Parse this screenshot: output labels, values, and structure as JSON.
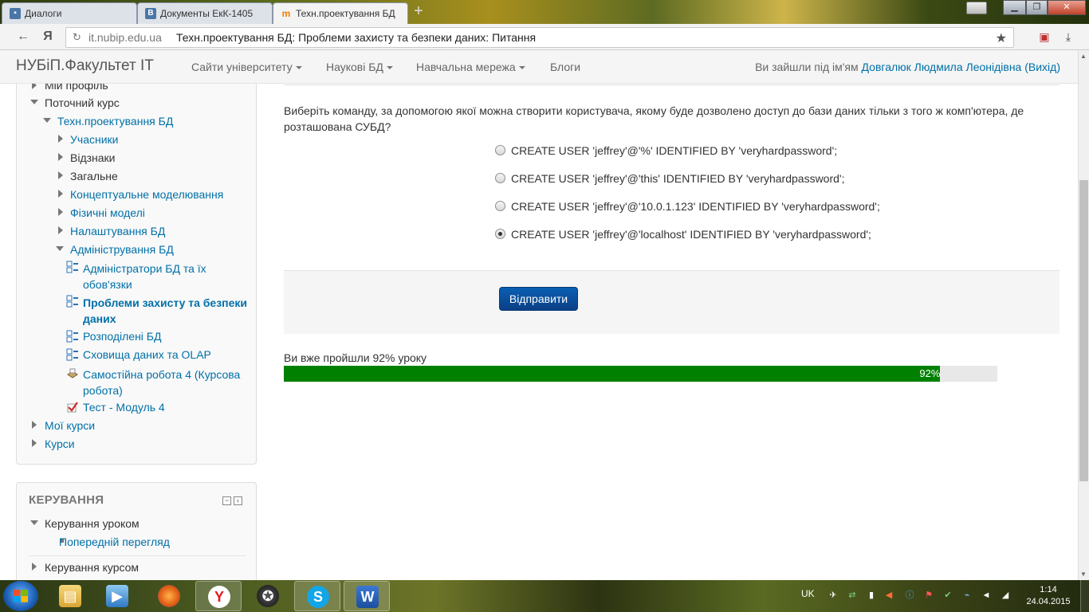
{
  "browser": {
    "tabs": [
      {
        "label": "Диалоги",
        "icon": "chat-icon",
        "active": false
      },
      {
        "label": "Документы ЕкК-1405",
        "icon": "vk-icon",
        "active": false
      },
      {
        "label": "Техн.проектування БД",
        "icon": "moodle-icon",
        "active": true
      }
    ],
    "address": {
      "domain": "it.nubip.edu.ua",
      "title": "Техн.проектування БД: Проблеми захисту та безпеки даних: Питання"
    },
    "yandex_glyph": "Я"
  },
  "site": {
    "brand": "НУБіП.Факультет ІТ",
    "nav": [
      {
        "label": "Сайти університету",
        "dropdown": true
      },
      {
        "label": "Наукові БД",
        "dropdown": true
      },
      {
        "label": "Навчальна мережа",
        "dropdown": true
      },
      {
        "label": "Блоги",
        "dropdown": false
      }
    ],
    "login": {
      "prefix": "Ви зайшли під ім'ям",
      "user": "Довгалюк Людмила Леонідівна",
      "logout": "(Вихід)"
    }
  },
  "navigation_block": {
    "items": [
      {
        "label": "Мій профіль"
      },
      {
        "label": "Поточний курс"
      },
      {
        "label": "Техн.проектування БД"
      },
      {
        "label": "Учасники"
      },
      {
        "label": "Відзнаки"
      },
      {
        "label": "Загальне"
      },
      {
        "label": "Концептуальне моделювання"
      },
      {
        "label": "Фізичні моделі"
      },
      {
        "label": "Налаштування БД"
      },
      {
        "label": "Адміністрування БД"
      },
      {
        "label": "Адміністратори БД та їх обов'язки"
      },
      {
        "label": "Проблеми захисту та безпеки даних"
      },
      {
        "label": "Розподілені БД"
      },
      {
        "label": "Сховища даних та OLAP"
      },
      {
        "label": "Самостійна робота 4 (Курсова робота)"
      },
      {
        "label": "Тест - Модуль 4"
      },
      {
        "label": "Мої курси"
      },
      {
        "label": "Курси"
      }
    ]
  },
  "admin_block": {
    "title": "КЕРУВАННЯ",
    "items": [
      {
        "label": "Керування уроком"
      },
      {
        "label": "Попередній перегляд"
      },
      {
        "label": "Керування курсом"
      }
    ]
  },
  "question": {
    "text": "Виберіть команду, за допомогою якої можна створити користувача, якому буде дозволено доступ до бази даних тільки з того ж комп'ютера, де розташована СУБД?",
    "answers": [
      {
        "label": "CREATE USER 'jeffrey'@'%' IDENTIFIED BY 'veryhardpassword';",
        "selected": false
      },
      {
        "label": "CREATE USER 'jeffrey'@'this' IDENTIFIED BY 'veryhardpassword';",
        "selected": false
      },
      {
        "label": "CREATE USER 'jeffrey'@'10.0.1.123' IDENTIFIED BY 'veryhardpassword';",
        "selected": false
      },
      {
        "label": "CREATE USER 'jeffrey'@'localhost' IDENTIFIED BY 'veryhardpassword';",
        "selected": true
      }
    ],
    "submit_label": "Відправити"
  },
  "progress": {
    "label": "Ви вже пройшли 92% уроку",
    "value_text": "92%",
    "percent": 92,
    "color": "#008000"
  },
  "taskbar": {
    "apps": [
      "file-explorer-icon",
      "media-player-icon",
      "firefox-icon",
      "yandex-browser-icon",
      "game-icon",
      "skype-icon",
      "word-icon"
    ],
    "tray": {
      "lang": "UK",
      "time": "1:14",
      "date": "24.04.2015"
    }
  }
}
